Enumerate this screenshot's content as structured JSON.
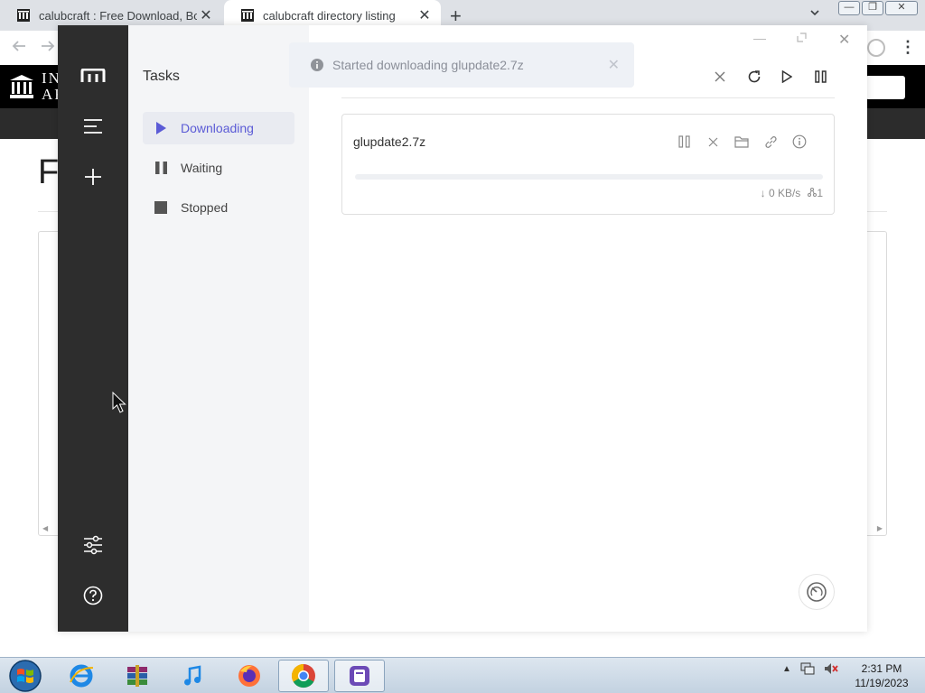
{
  "browser": {
    "tabs": [
      {
        "title": "calubcraft : Free Download, Borrow",
        "active": false
      },
      {
        "title": "calubcraft directory listing",
        "active": true
      }
    ],
    "new_tab_symbol": "+",
    "close_symbol": "✕",
    "window_controls": {
      "minimize": "—",
      "restore": "❐",
      "close": "✕"
    }
  },
  "website": {
    "logo_text_line1": "IN",
    "logo_text_line2": "AR",
    "heading_partial": "F"
  },
  "motrix": {
    "sidebar": {
      "logo_icon": "motrix-logo-icon",
      "menu_icon": "menu-icon",
      "add_icon": "plus-icon",
      "preferences_icon": "sliders-icon",
      "help_icon": "help-icon"
    },
    "subnav": {
      "title": "Tasks",
      "items": [
        {
          "label": "Downloading",
          "icon": "play-icon",
          "active": true
        },
        {
          "label": "Waiting",
          "icon": "pause-icon",
          "active": false
        },
        {
          "label": "Stopped",
          "icon": "stop-icon",
          "active": false
        }
      ]
    },
    "toolbar": {
      "delete_icon": "close-icon",
      "refresh_icon": "refresh-icon",
      "resume_all_icon": "play-icon",
      "pause_all_icon": "pause-icon"
    },
    "task": {
      "name": "glupdate2.7z",
      "progress": 0,
      "speed": "↓ 0 KB/s",
      "connections": "1"
    },
    "toast": {
      "message": "Started downloading glupdate2.7z",
      "close_symbol": "✕"
    },
    "accent_color": "#5b5bd6"
  },
  "taskbar": {
    "apps": [
      "internet-explorer-icon",
      "winrar-icon",
      "itunes-icon",
      "firefox-icon",
      "chrome-icon",
      "motrix-icon"
    ],
    "time": "2:31 PM",
    "date": "11/19/2023"
  }
}
